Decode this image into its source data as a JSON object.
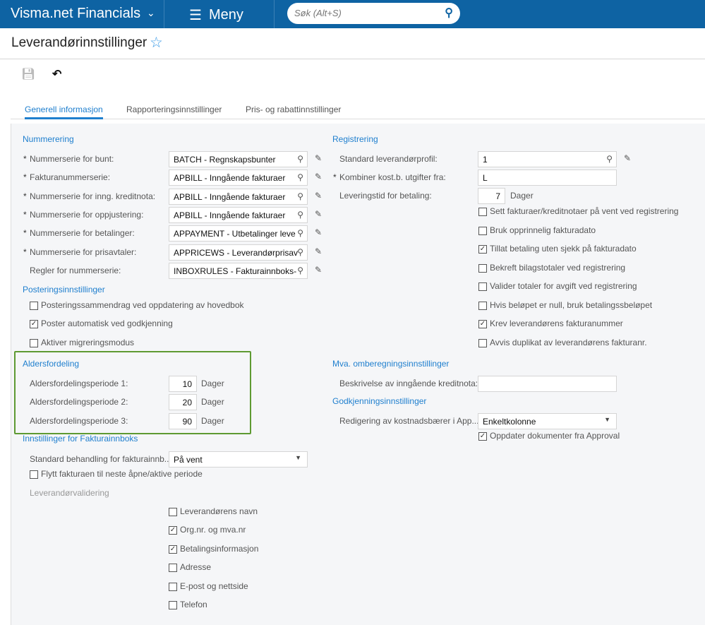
{
  "header": {
    "brand": "Visma.net Financials",
    "menu": "Meny",
    "search_placeholder": "Søk (Alt+S)"
  },
  "page": {
    "title": "Leverandørinnstillinger"
  },
  "tabs": [
    {
      "label": "Generell informasjon",
      "active": true
    },
    {
      "label": "Rapporteringsinnstillinger"
    },
    {
      "label": "Pris- og rabattinnstillinger"
    }
  ],
  "left": {
    "numbering": {
      "heading": "Nummerering",
      "rows": [
        {
          "label": "Nummerserie for bunt:",
          "required": true,
          "value": "BATCH - Regnskapsbunter"
        },
        {
          "label": "Fakturanummerserie:",
          "required": true,
          "value": "APBILL - Inngående fakturaer"
        },
        {
          "label": "Nummerserie for inng. kreditnota:",
          "required": true,
          "value": "APBILL - Inngående fakturaer"
        },
        {
          "label": "Nummerserie for oppjustering:",
          "required": true,
          "value": "APBILL - Inngående fakturaer"
        },
        {
          "label": "Nummerserie for betalinger:",
          "required": true,
          "value": "APPAYMENT - Utbetalinger leve"
        },
        {
          "label": "Nummerserie for prisavtaler:",
          "required": true,
          "value": "APPRICEWS - Leverandørprisav"
        },
        {
          "label": "Regler for nummerserie:",
          "required": false,
          "value": "INBOXRULES - Fakturainnboks-"
        }
      ]
    },
    "posting": {
      "heading": "Posteringsinnstillinger",
      "checks": [
        {
          "label": "Posteringssammendrag ved oppdatering av hovedbok",
          "checked": false
        },
        {
          "label": "Poster automatisk ved godkjenning",
          "checked": true
        },
        {
          "label": "Aktiver migreringsmodus",
          "checked": false
        }
      ]
    },
    "aging": {
      "heading": "Aldersfordeling",
      "unit": "Dager",
      "rows": [
        {
          "label": "Aldersfordelingsperiode 1:",
          "value": "10"
        },
        {
          "label": "Aldersfordelingsperiode 2:",
          "value": "20"
        },
        {
          "label": "Aldersfordelingsperiode 3:",
          "value": "90"
        }
      ]
    },
    "inbox": {
      "heading": "Innstillinger for Fakturainnboks",
      "select_label": "Standard behandling for fakturainnb...",
      "select_value": "På vent",
      "move_check": {
        "label": "Flytt fakturaen til neste åpne/aktive periode",
        "checked": false
      },
      "validation_label": "Leverandørvalidering",
      "validation": [
        {
          "label": "Leverandørens navn",
          "checked": false
        },
        {
          "label": "Org.nr. og mva.nr",
          "checked": true
        },
        {
          "label": "Betalingsinformasjon",
          "checked": true
        },
        {
          "label": "Adresse",
          "checked": false
        },
        {
          "label": "E-post og nettside",
          "checked": false
        },
        {
          "label": "Telefon",
          "checked": false
        }
      ]
    }
  },
  "right": {
    "registration": {
      "heading": "Registrering",
      "profile_label": "Standard leverandørprofil:",
      "profile_value": "1",
      "combine_label": "Kombiner kost.b. utgifter fra:",
      "combine_value": "L",
      "lead_label": "Leveringstid for betaling:",
      "lead_value": "7",
      "lead_unit": "Dager",
      "checks": [
        {
          "label": "Sett fakturaer/kreditnotaer på vent ved registrering",
          "checked": false
        },
        {
          "label": "Bruk opprinnelig fakturadato",
          "checked": false
        },
        {
          "label": "Tillat betaling uten sjekk på fakturadato",
          "checked": true
        },
        {
          "label": "Bekreft bilagstotaler ved registrering",
          "checked": false
        },
        {
          "label": "Valider totaler for avgift ved registrering",
          "checked": false
        },
        {
          "label": "Hvis beløpet er null, bruk betalingssbeløpet",
          "checked": false
        },
        {
          "label": "Krev leverandørens fakturanummer",
          "checked": true
        },
        {
          "label": "Avvis duplikat av leverandørens fakturanr.",
          "checked": false
        }
      ]
    },
    "vat": {
      "heading": "Mva. omberegningsinnstillinger",
      "desc_label": "Beskrivelse av inngående kreditnota:",
      "desc_value": ""
    },
    "approval": {
      "heading": "Godkjenningsinnstillinger",
      "select_label": "Redigering av kostnadsbærer i App...",
      "select_value": "Enkeltkolonne",
      "check": {
        "label": "Oppdater dokumenter fra Approval",
        "checked": true
      }
    }
  }
}
